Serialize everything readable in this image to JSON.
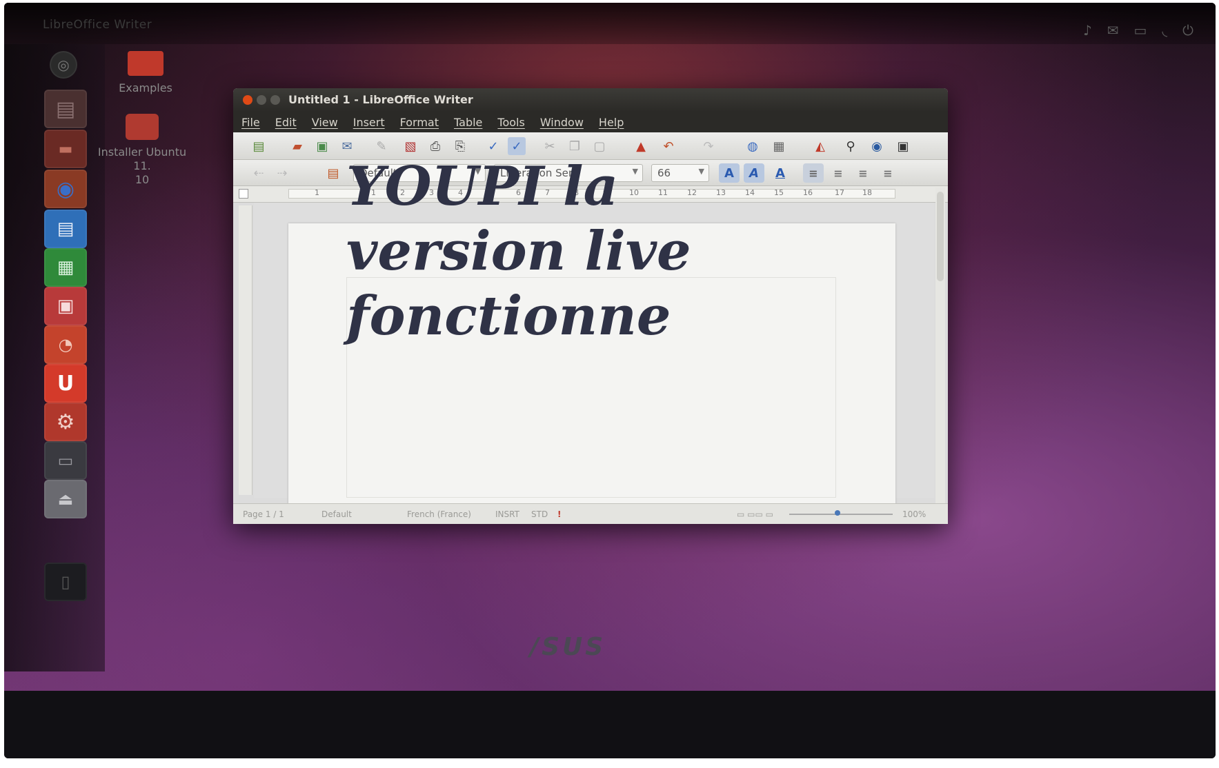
{
  "desktop": {
    "panel_title": "LibreOffice Writer",
    "tray_icons": [
      "music-icon",
      "mail-icon",
      "battery-icon",
      "wifi-icon",
      "power-icon"
    ],
    "icons": [
      {
        "label": "Examples",
        "icon": "folder-icon"
      },
      {
        "label": "Installer Ubuntu 11.\n10",
        "icon": "installer-icon"
      }
    ],
    "launcher_items": [
      {
        "name": "dash-icon",
        "color": "#3a3a3a"
      },
      {
        "name": "files-icon",
        "color": "#5a3a3a"
      },
      {
        "name": "firefox-icon",
        "color": "#b44a2a"
      },
      {
        "name": "writer-icon",
        "color": "#2f6fb8"
      },
      {
        "name": "calc-icon",
        "color": "#2f8a3a"
      },
      {
        "name": "impress-icon",
        "color": "#b83a3a"
      },
      {
        "name": "software-center-icon",
        "color": "#c4432c"
      },
      {
        "name": "ubuntu-one-icon",
        "color": "#d43a2a",
        "glyph": "U"
      },
      {
        "name": "settings-icon",
        "color": "#b0382c"
      },
      {
        "name": "workspaces-icon",
        "color": "#3a3a40"
      },
      {
        "name": "drive-icon",
        "color": "#6a6a70"
      }
    ]
  },
  "window": {
    "title": "Untitled 1 - LibreOffice Writer",
    "menu": [
      "File",
      "Edit",
      "View",
      "Insert",
      "Format",
      "Table",
      "Tools",
      "Window",
      "Help"
    ],
    "paragraph_style": "Default",
    "font_name": "Liberation Serif",
    "font_size": "66",
    "ruler_ticks": [
      "1",
      "1",
      "2",
      "3",
      "4",
      "5",
      "6",
      "7",
      "8",
      "9",
      "10",
      "11",
      "12",
      "13",
      "14",
      "15",
      "16",
      "17",
      "18"
    ],
    "document_text": "YOUPI la\nversion live\nfonctionne",
    "status": {
      "page": "Page 1 / 1",
      "style": "Default",
      "language": "French (France)",
      "insert_mode": "INSRT",
      "selection_mode": "STD",
      "zoom": "100%"
    }
  },
  "brand": "/SUS",
  "colors": {
    "accent_close": "#df4a16",
    "window_dark": "#2b2a27",
    "document_text": "#2f3246"
  }
}
